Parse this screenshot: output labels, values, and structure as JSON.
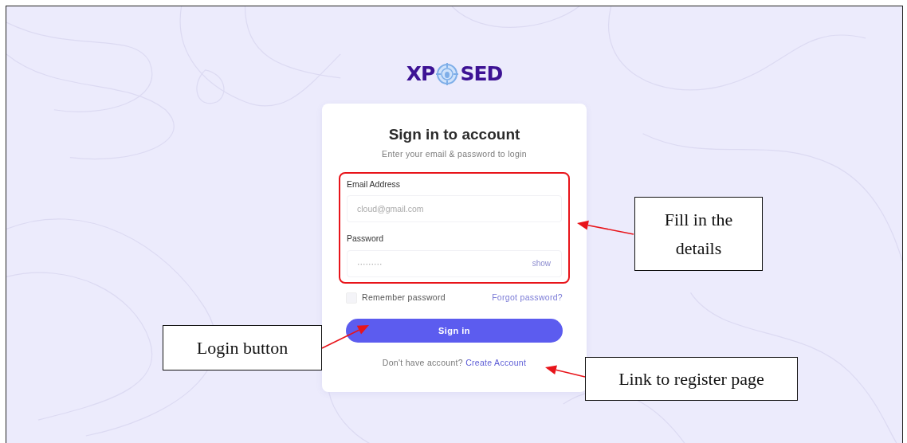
{
  "logo": {
    "left": "XP",
    "right": "SED"
  },
  "card": {
    "title": "Sign in to account",
    "subtitle": "Enter your email & password to login",
    "fields": [
      {
        "label": "Email Address",
        "placeholder": "cloud@gmail.com"
      },
      {
        "label": "Password",
        "value": "·········",
        "toggle": "show"
      }
    ],
    "remember": {
      "label": "Remember password",
      "checked": false
    },
    "forgot": "Forgot password?",
    "submit": "Sign in",
    "footer": {
      "text": "Don't have account?",
      "link": "Create Account"
    }
  },
  "annotations": [
    {
      "text": "Fill in the details"
    },
    {
      "text": "Login button"
    },
    {
      "text": "Link to register page"
    }
  ]
}
